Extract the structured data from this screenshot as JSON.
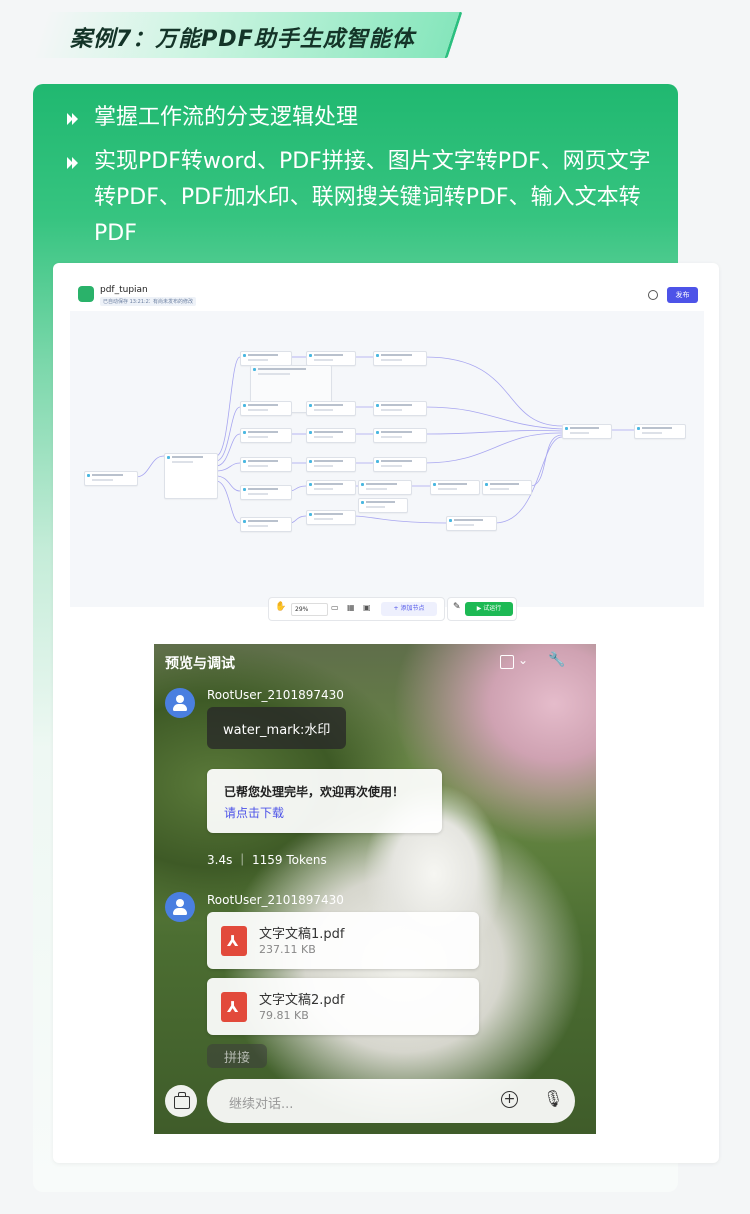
{
  "header": {
    "case_title": "案例7：万能PDF助手生成智能体"
  },
  "bullets": [
    "掌握工作流的分支逻辑处理",
    "实现PDF转word、PDF拼接、图片文字转PDF、网页文字转PDF、PDF加水印、联网搜关键词转PDF、输入文本转PDF"
  ],
  "workflow": {
    "name": "pdf_tupian",
    "autosave": "已自动保存 13:21:23",
    "unpublished": "有尚未发布的修改",
    "publish_label": "发布",
    "zoom": "29%",
    "add_node_label": "+ 添加节点",
    "run_label": "▶ 试运行"
  },
  "preview": {
    "title": "预览与调试",
    "messages": [
      {
        "user": "RootUser_2101897430",
        "text": "water_mark:水印"
      },
      {
        "line1": "已帮您处理完毕，欢迎再次使用！",
        "link": "请点击下载"
      },
      {
        "stats": "3.4s ｜ 1159 Tokens"
      },
      {
        "user": "RootUser_2101897430"
      }
    ],
    "files": [
      {
        "name": "文字文稿1.pdf",
        "size": "237.11 KB"
      },
      {
        "name": "文字文稿2.pdf",
        "size": "79.81 KB"
      }
    ],
    "partial_label": "拼接",
    "input_placeholder": "继续对话..."
  },
  "colors": {
    "brand_green": "#20b870",
    "publish_blue": "#4d53e8",
    "run_green": "#1db954",
    "pdf_red": "#e24a3b"
  }
}
